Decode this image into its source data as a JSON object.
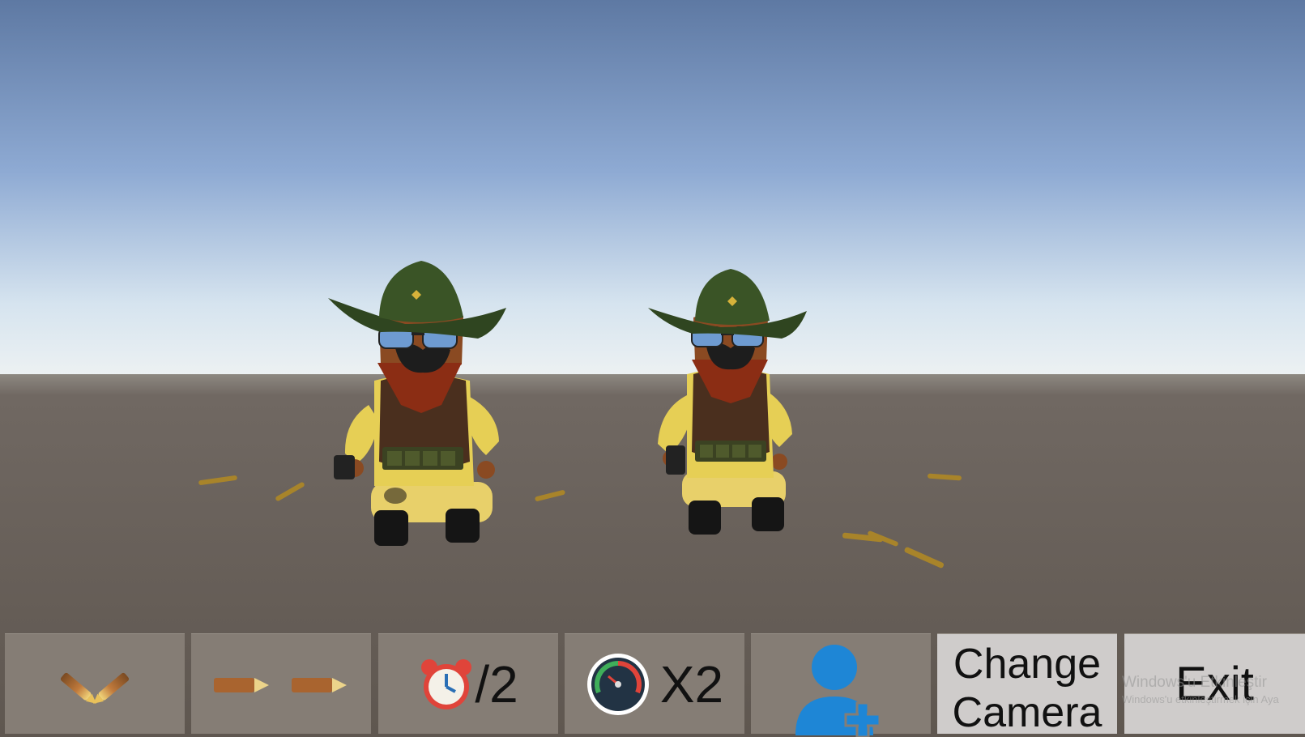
{
  "scene": {
    "sky_top": "#5e79a3",
    "sky_horizon": "#eef2f3",
    "ground": "#6a625c",
    "characters": [
      {
        "name": "cowboy",
        "hat_color": "#2f4520",
        "shirt_color": "#e6cf55",
        "vest_color": "#4a2f1e"
      },
      {
        "name": "cowboy",
        "hat_color": "#2f4520",
        "shirt_color": "#e6cf55",
        "vest_color": "#4a2f1e"
      }
    ],
    "bullet_color": "#b08a2a"
  },
  "toolbar": {
    "buttons": [
      {
        "id": "double-shot",
        "icon": "crossed-bullets-icon"
      },
      {
        "id": "rapid-fire",
        "icon": "bullets-icon"
      },
      {
        "id": "slow-time",
        "icon": "alarm-clock-icon",
        "label": "/2"
      },
      {
        "id": "speed",
        "icon": "speedometer-icon",
        "label": "X2"
      },
      {
        "id": "add-player",
        "icon": "add-user-icon"
      },
      {
        "id": "change-camera",
        "label_line1": "Change",
        "label_line2": "Camera"
      },
      {
        "id": "exit",
        "label": "Exit"
      }
    ]
  },
  "watermark": {
    "line1": "Windows'u Etkinleştir",
    "line2": "Windows'u etkinleştirmek için Aya"
  }
}
